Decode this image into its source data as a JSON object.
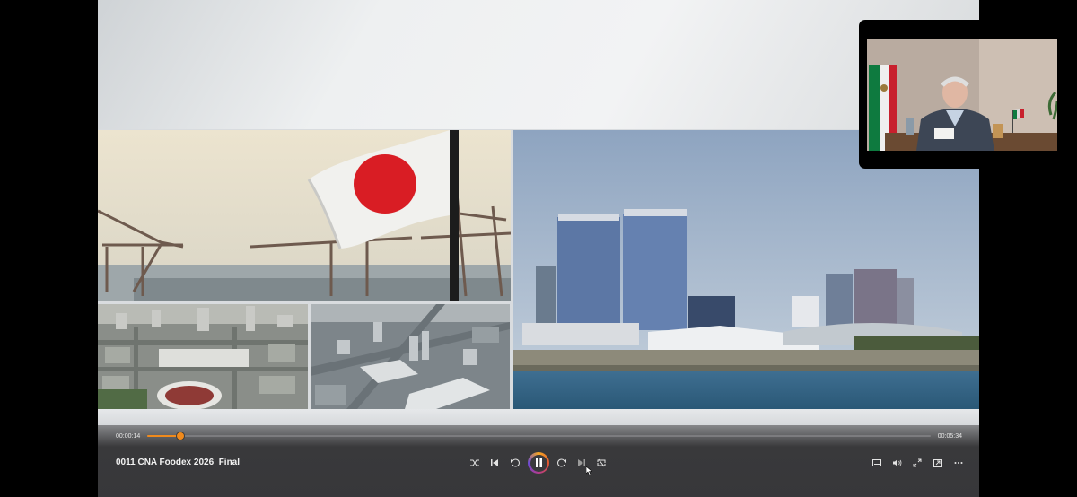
{
  "player": {
    "video_title": "0011 CNA Foodex 2026_Final",
    "time_current": "00:00:14",
    "time_total": "00:05:34",
    "progress_fraction": 0.042,
    "accent_color": "#f08a1c"
  },
  "controls": {
    "left": [
      "shuffle-icon",
      "previous-icon",
      "rewind-icon"
    ],
    "center": "pause-icon",
    "right_of_center": [
      "fast-forward-icon",
      "next-icon",
      "repeat-icon"
    ],
    "far_right": [
      "subtitles-icon",
      "volume-icon",
      "fullscreen-icon",
      "miniplayer-icon",
      "more-icon"
    ]
  },
  "slide": {
    "images": [
      "japan-flag-port-image",
      "aerial-city-image-1",
      "aerial-city-image-2",
      "waterfront-city-image"
    ]
  },
  "webcam": {
    "description_icon": "webcam-participant-image"
  }
}
